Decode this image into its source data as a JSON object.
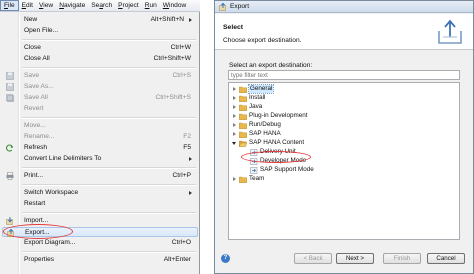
{
  "menubar": {
    "items": [
      {
        "label": "File",
        "accel": "F",
        "rest": "ile"
      },
      {
        "label": "Edit",
        "accel": "E",
        "rest": "dit"
      },
      {
        "label": "View",
        "accel": "V",
        "rest": "iew"
      },
      {
        "label": "Navigate",
        "accel": "N",
        "rest": "avigate"
      },
      {
        "label": "Search",
        "accel": "a",
        "pre": "Se",
        "rest": "rch"
      },
      {
        "label": "Project",
        "accel": "P",
        "rest": "roject"
      },
      {
        "label": "Run",
        "accel": "R",
        "rest": "un"
      },
      {
        "label": "Window",
        "accel": "W",
        "rest": "indow"
      }
    ]
  },
  "file_menu": {
    "new": {
      "label": "New",
      "shortcut": "Alt+Shift+N"
    },
    "open_file": {
      "label": "Open File..."
    },
    "close": {
      "label": "Close",
      "shortcut": "Ctrl+W"
    },
    "close_all": {
      "label": "Close All",
      "shortcut": "Ctrl+Shift+W"
    },
    "save": {
      "label": "Save",
      "shortcut": "Ctrl+S"
    },
    "save_as": {
      "label": "Save As..."
    },
    "save_all": {
      "label": "Save All",
      "shortcut": "Ctrl+Shift+S"
    },
    "revert": {
      "label": "Revert"
    },
    "move": {
      "label": "Move..."
    },
    "rename": {
      "label": "Rename...",
      "shortcut": "F2"
    },
    "refresh": {
      "label": "Refresh",
      "shortcut": "F5"
    },
    "convert": {
      "label": "Convert Line Delimiters To"
    },
    "print": {
      "label": "Print...",
      "shortcut": "Ctrl+P"
    },
    "switch_workspace": {
      "label": "Switch Workspace"
    },
    "restart": {
      "label": "Restart"
    },
    "import": {
      "label": "Import..."
    },
    "export": {
      "label": "Export..."
    },
    "export_diagram": {
      "label": "Export Diagram...",
      "shortcut": "Ctrl+O"
    },
    "properties": {
      "label": "Properties",
      "shortcut": "Alt+Enter"
    }
  },
  "dialog": {
    "title": "Export",
    "heading": "Select",
    "subheading": "Choose export destination.",
    "select_label": "Select an export destination:",
    "filter_placeholder": "type filter text",
    "tree": {
      "general": "General",
      "install": "Install",
      "java": "Java",
      "plugin_dev": "Plug-in Development",
      "run_debug": "Run/Debug",
      "sap_hana": "SAP HANA",
      "sap_hana_content": "SAP HANA Content",
      "delivery_unit": "Delivery Unit",
      "developer_mode": "Developer Mode",
      "sap_support_mode": "SAP Support Mode",
      "team": "Team"
    },
    "buttons": {
      "back": "< Back",
      "next": "Next >",
      "finish": "Finish",
      "cancel": "Cancel"
    },
    "help": "?"
  },
  "colors": {
    "annotation": "#e23b3b",
    "folder": "#e8b84a",
    "selection": "#cde8ff",
    "menu_highlight": "#d9e7f8"
  }
}
